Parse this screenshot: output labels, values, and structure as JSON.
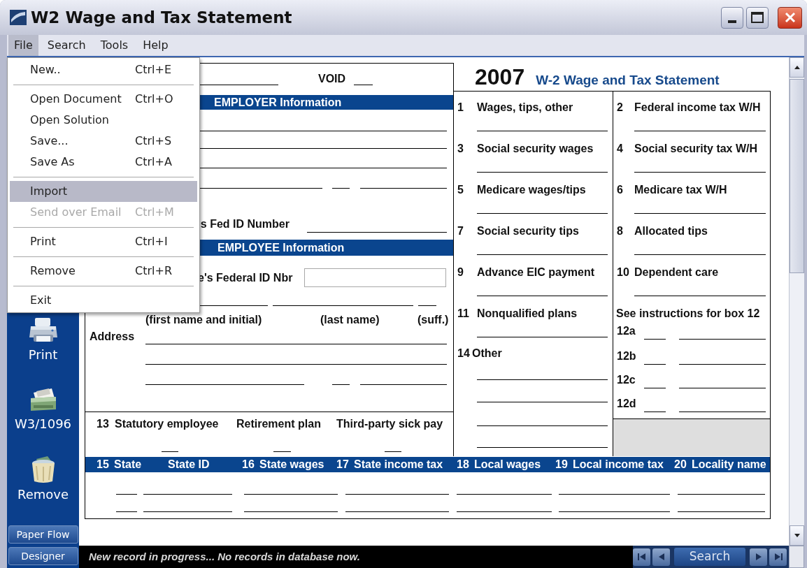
{
  "window": {
    "title": "W2 Wage and Tax Statement"
  },
  "menu_bar": [
    {
      "label": "File",
      "selected": true
    },
    {
      "label": "Search",
      "selected": false
    },
    {
      "label": "Tools",
      "selected": false
    },
    {
      "label": "Help",
      "selected": false
    }
  ],
  "file_menu": [
    {
      "kind": "item",
      "label": "New..",
      "shortcut": "Ctrl+E",
      "selected": false,
      "disabled": false
    },
    {
      "kind": "separator"
    },
    {
      "kind": "item",
      "label": "Open Document",
      "shortcut": "Ctrl+O",
      "selected": false,
      "disabled": false
    },
    {
      "kind": "item",
      "label": "Open Solution",
      "selected": false,
      "disabled": false
    },
    {
      "kind": "item",
      "label": "Save...",
      "shortcut": "Ctrl+S",
      "selected": false,
      "disabled": false
    },
    {
      "kind": "item",
      "label": "Save As",
      "shortcut": "Ctrl+A",
      "selected": false,
      "disabled": false
    },
    {
      "kind": "separator"
    },
    {
      "kind": "item",
      "label": "Import",
      "selected": true,
      "disabled": false
    },
    {
      "kind": "item",
      "label": "Send over Email",
      "shortcut": "Ctrl+M",
      "selected": false,
      "disabled": true
    },
    {
      "kind": "separator"
    },
    {
      "kind": "item",
      "label": "Print",
      "shortcut": "Ctrl+I",
      "selected": false,
      "disabled": false
    },
    {
      "kind": "separator"
    },
    {
      "kind": "item",
      "label": "Remove",
      "shortcut": "Ctrl+R",
      "selected": false,
      "disabled": false
    },
    {
      "kind": "separator"
    },
    {
      "kind": "item",
      "label": "Exit",
      "selected": false,
      "disabled": false
    }
  ],
  "sidebar": {
    "items": [
      {
        "kind": "printer",
        "label": "Print"
      },
      {
        "kind": "tray",
        "label": "W3/1096"
      },
      {
        "kind": "trash",
        "label": "Remove"
      }
    ],
    "buttons": [
      "Paper Flow",
      "Designer"
    ]
  },
  "form": {
    "void_label": "VOID",
    "employer_header": "EMPLOYER Information",
    "employer_id_label": "'s Fed ID Number",
    "employee_header": "EMPLOYEE Information",
    "employee_id_label": "e's Federal ID Nbr",
    "name_labels": [
      "(first name and initial)",
      "(last name)",
      "(suff.)"
    ],
    "address_label": "Address",
    "box13": {
      "number": "13",
      "options": [
        "Statutory employee",
        "Retirement plan",
        "Third-party sick pay"
      ]
    },
    "year": "2007",
    "title": "W-2 Wage and Tax Statement",
    "boxes": [
      {
        "number": "1",
        "label": "Wages, tips, other"
      },
      {
        "number": "2",
        "label": "Federal income tax W/H"
      },
      {
        "number": "3",
        "label": "Social security wages"
      },
      {
        "number": "4",
        "label": "Social security tax W/H"
      },
      {
        "number": "5",
        "label": "Medicare wages/tips"
      },
      {
        "number": "6",
        "label": "Medicare tax W/H"
      },
      {
        "number": "7",
        "label": "Social security tips"
      },
      {
        "number": "8",
        "label": "Allocated tips"
      },
      {
        "number": "9",
        "label": "Advance EIC payment"
      },
      {
        "number": "10",
        "label": "Dependent care"
      },
      {
        "number": "11",
        "label": "Nonqualified plans"
      }
    ],
    "box12": {
      "label": "See instructions for box 12",
      "codes": [
        "12a",
        "12b",
        "12c",
        "12d"
      ]
    },
    "box14": {
      "number": "14",
      "label": "Other"
    },
    "state_columns": [
      {
        "number": "15",
        "label": "State"
      },
      {
        "label": "State ID"
      },
      {
        "number": "16",
        "label": "State wages"
      },
      {
        "number": "17",
        "label": "State income tax"
      },
      {
        "number": "18",
        "label": "Local wages"
      },
      {
        "number": "19",
        "label": "Local income tax"
      },
      {
        "number": "20",
        "label": "Locality name"
      }
    ]
  },
  "status_bar": {
    "message": "New record in progress... No records in database now."
  },
  "navigation": {
    "search_button": "Search"
  }
}
